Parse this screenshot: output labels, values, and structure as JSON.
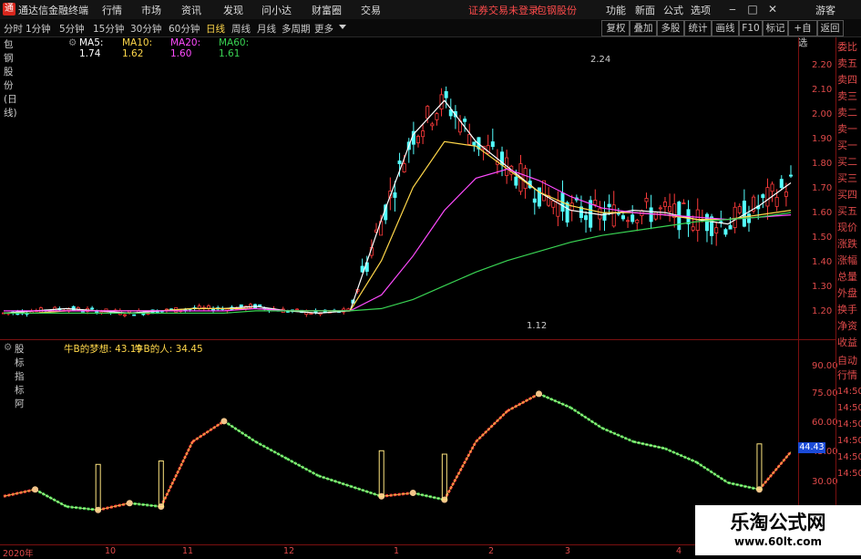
{
  "menubar": {
    "app_title": "通达信金融终端",
    "menus": [
      "行情",
      "市场",
      "资讯",
      "发现",
      "问小达",
      "财富圈",
      "交易"
    ],
    "notice": "证券交易未登录",
    "stock_name": "包钢股份",
    "right_menus": [
      "功能",
      "新面",
      "公式",
      "选项"
    ],
    "guest": "游客"
  },
  "toolbar": {
    "periods": [
      "分时",
      "1分钟",
      "5分钟",
      "15分钟",
      "30分钟",
      "60分钟",
      "日线",
      "周线",
      "月线",
      "多周期",
      "更多"
    ],
    "active_period": "日线",
    "right_buttons": [
      "复权",
      "叠加",
      "多股",
      "统计",
      "画线",
      "F10",
      "标记",
      "+自选",
      "返回"
    ]
  },
  "legend": {
    "title": "包钢股份(日线)",
    "ma": [
      {
        "label": "MA5: 1.74",
        "color": "#ffffff"
      },
      {
        "label": "MA10: 1.62",
        "color": "#ffd74a"
      },
      {
        "label": "MA20: 1.60",
        "color": "#ff4bff"
      },
      {
        "label": "MA60: 1.61",
        "color": "#39d353"
      }
    ]
  },
  "sub_indicator": {
    "title": "股标指标阿",
    "line1": "牛B的梦想: 43.19",
    "line2": "牛B的人: 34.45",
    "current_value": "44.43"
  },
  "sidebar": [
    "委比",
    "卖五",
    "卖四",
    "卖三",
    "卖二",
    "卖一",
    "买一",
    "买二",
    "买三",
    "买四",
    "买五",
    "现价",
    "涨跌",
    "涨幅",
    "总量",
    "外盘",
    "换手",
    "净资",
    "收益",
    "自动",
    "行情"
  ],
  "price_axis": [
    "2.20",
    "2.10",
    "2.00",
    "1.90",
    "1.80",
    "1.70",
    "1.60",
    "1.50",
    "1.40",
    "1.30",
    "1.20"
  ],
  "sub_axis": [
    "90.00",
    "75.00",
    "60.00",
    "45.00",
    "30.00"
  ],
  "sub_axis_right": [
    "14:50",
    "14:50",
    "14:50",
    "14:50",
    "14:50",
    "14:50"
  ],
  "annotations": {
    "high": "2.24",
    "low": "1.12"
  },
  "dates": [
    "2020年",
    "10",
    "11",
    "12",
    "1",
    "2",
    "3",
    "4"
  ],
  "watermark": {
    "name": "乐淘公式网",
    "url": "www.60lt.com"
  },
  "colors": {
    "up": "#ff3b3b",
    "down": "#54ffff",
    "panel_border": "#7a1010",
    "axis_text": "#e04a4a"
  },
  "chart_data": {
    "type": "line",
    "title": "包钢股份(日线)",
    "series": [
      {
        "name": "MA5",
        "values": [
          1.17,
          1.18,
          1.19,
          1.18,
          1.17,
          1.18,
          1.19,
          1.19,
          1.2,
          1.18,
          1.17,
          1.18,
          1.58,
          1.95,
          2.1,
          1.92,
          1.81,
          1.7,
          1.62,
          1.6,
          1.62,
          1.61,
          1.58,
          1.56,
          1.64,
          1.74
        ]
      },
      {
        "name": "MA10",
        "values": [
          1.17,
          1.17,
          1.18,
          1.18,
          1.18,
          1.18,
          1.19,
          1.19,
          1.19,
          1.18,
          1.18,
          1.18,
          1.4,
          1.72,
          1.92,
          1.9,
          1.8,
          1.7,
          1.64,
          1.61,
          1.61,
          1.6,
          1.58,
          1.58,
          1.6,
          1.62
        ]
      },
      {
        "name": "MA20",
        "values": [
          1.18,
          1.18,
          1.18,
          1.18,
          1.18,
          1.18,
          1.18,
          1.18,
          1.19,
          1.18,
          1.18,
          1.18,
          1.25,
          1.42,
          1.62,
          1.76,
          1.8,
          1.75,
          1.68,
          1.63,
          1.61,
          1.6,
          1.59,
          1.58,
          1.59,
          1.6
        ]
      },
      {
        "name": "MA60",
        "values": [
          1.17,
          1.17,
          1.17,
          1.17,
          1.17,
          1.17,
          1.17,
          1.17,
          1.18,
          1.18,
          1.18,
          1.18,
          1.19,
          1.23,
          1.29,
          1.35,
          1.4,
          1.44,
          1.48,
          1.51,
          1.53,
          1.55,
          1.57,
          1.58,
          1.59,
          1.61
        ]
      }
    ],
    "sub_series": [
      {
        "name": "牛B的梦想",
        "values": [
          18,
          22,
          12,
          10,
          14,
          12,
          50,
          62,
          50,
          40,
          30,
          24,
          18,
          20,
          16,
          50,
          68,
          78,
          70,
          58,
          50,
          46,
          38,
          26,
          22,
          44
        ]
      }
    ],
    "ylim": [
      1.1,
      2.28
    ],
    "sub_ylim": [
      0,
      95
    ]
  }
}
